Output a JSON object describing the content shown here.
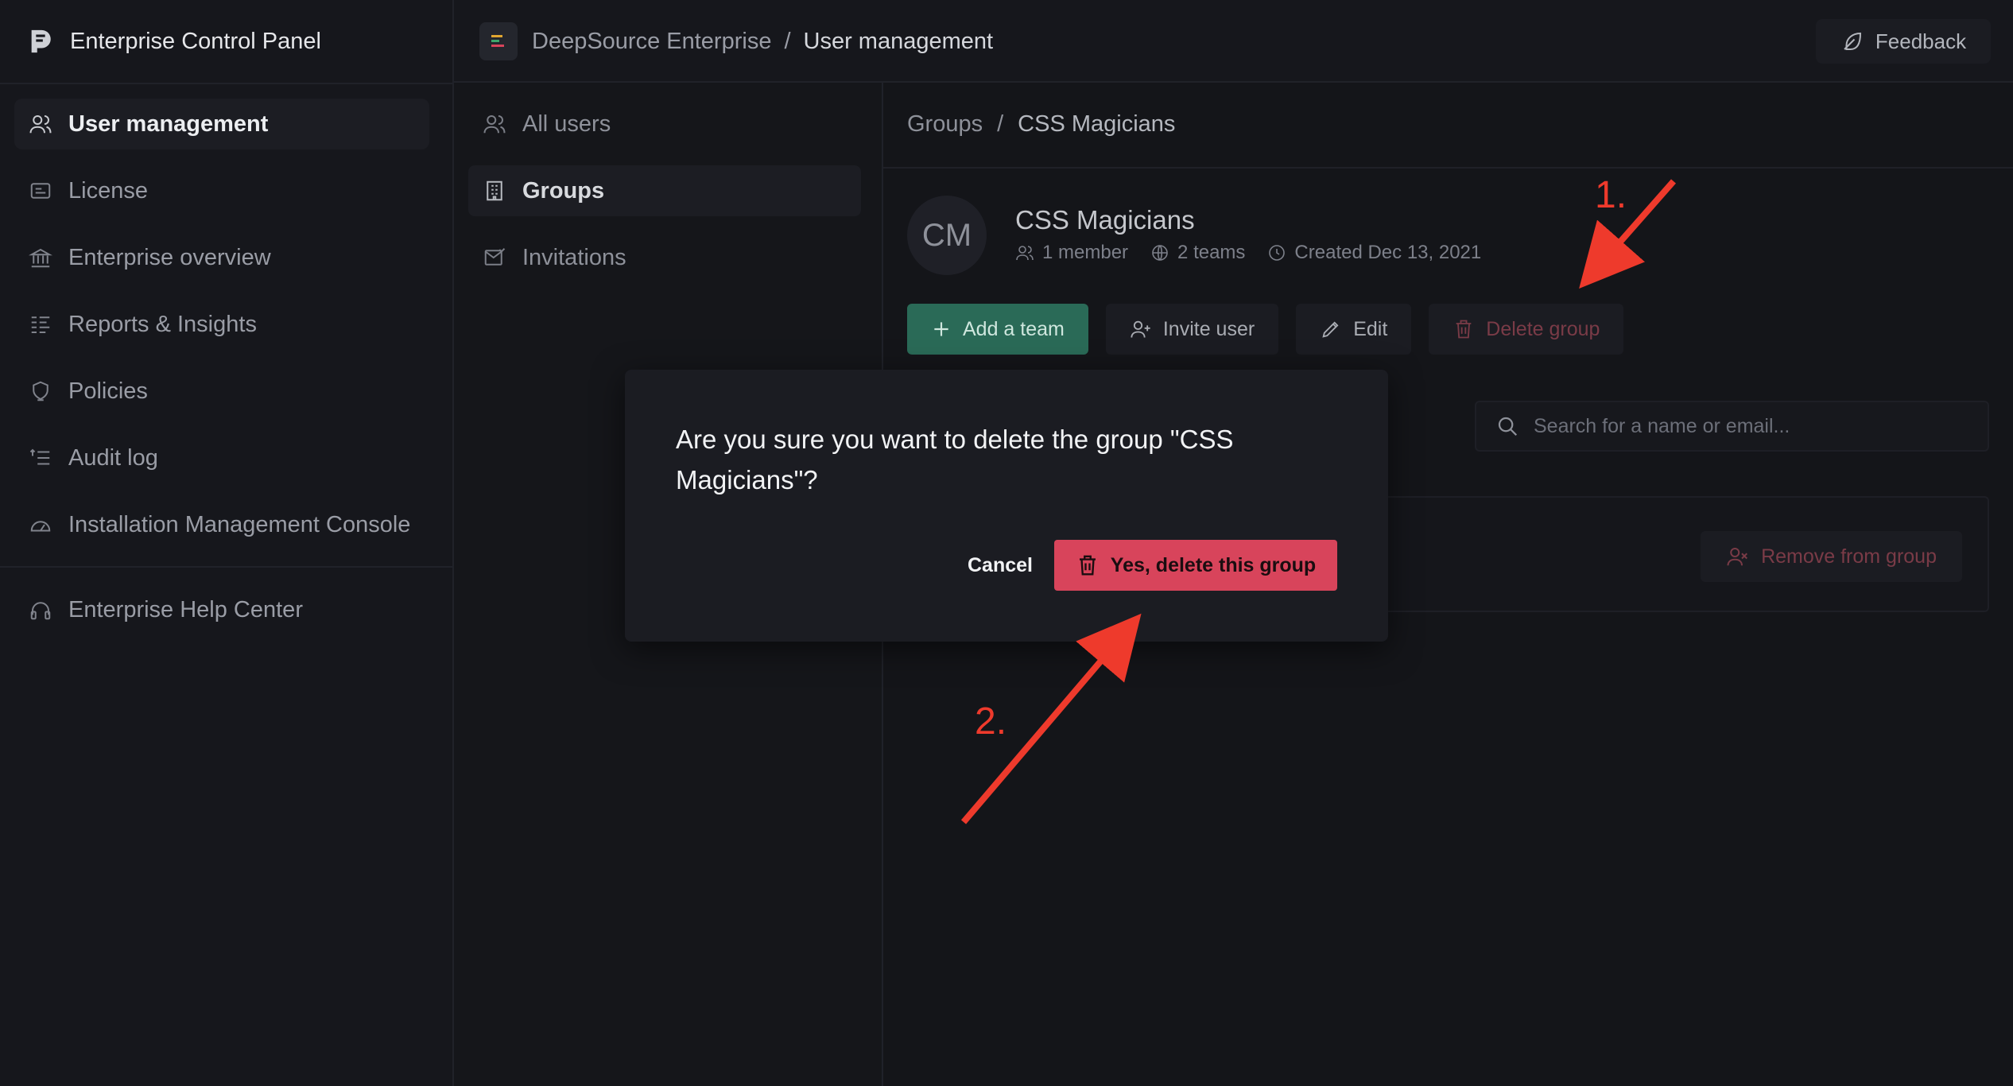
{
  "sidebar": {
    "brand": "Enterprise Control Panel",
    "items": [
      {
        "label": "User management"
      },
      {
        "label": "License"
      },
      {
        "label": "Enterprise overview"
      },
      {
        "label": "Reports & Insights"
      },
      {
        "label": "Policies"
      },
      {
        "label": "Audit log"
      },
      {
        "label": "Installation Management Console"
      }
    ],
    "help": "Enterprise Help Center"
  },
  "topbar": {
    "org": "DeepSource Enterprise",
    "separator": "/",
    "section": "User management",
    "feedback": "Feedback"
  },
  "subnav": {
    "items": [
      {
        "label": "All users"
      },
      {
        "label": "Groups"
      },
      {
        "label": "Invitations"
      }
    ]
  },
  "main": {
    "breadcrumb": {
      "parent": "Groups",
      "separator": "/",
      "current": "CSS Magicians"
    },
    "group": {
      "initials": "CM",
      "name": "CSS Magicians",
      "members": "1 member",
      "teams": "2 teams",
      "created": "Created Dec 13, 2021"
    },
    "actions": {
      "add_team": "Add a team",
      "invite": "Invite user",
      "edit": "Edit",
      "delete": "Delete group"
    },
    "search_placeholder": "Search for a name or email...",
    "remove": "Remove from group"
  },
  "modal": {
    "message": "Are you sure you want to delete the group \"CSS Magicians\"?",
    "cancel": "Cancel",
    "confirm": "Yes, delete this group"
  },
  "annotations": {
    "step1": "1.",
    "step2": "2."
  },
  "colors": {
    "background": "#141519",
    "primary_button": "#2a6a57",
    "danger": "#d8445b",
    "annotation": "#ee3a2c"
  }
}
